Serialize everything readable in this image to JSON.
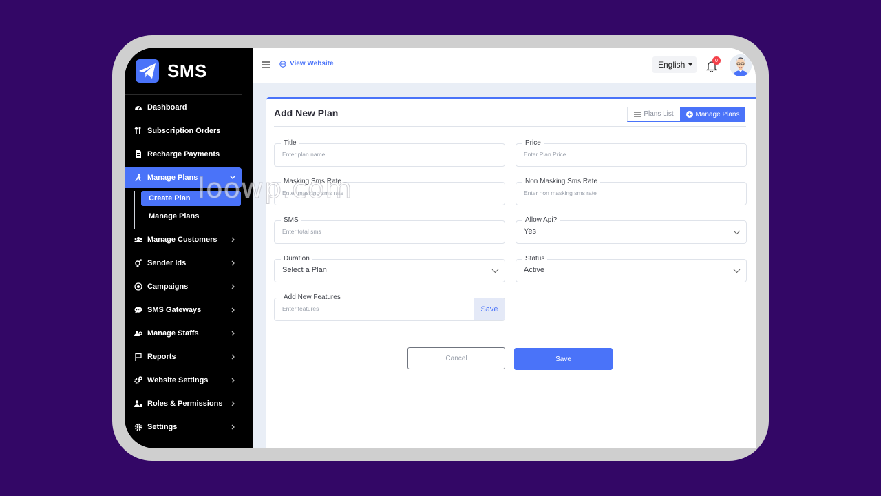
{
  "brand": {
    "name": "SMS",
    "accent": "#4a73f9"
  },
  "topbar": {
    "view_website": "View Website",
    "language": "English",
    "notification_count": "0"
  },
  "sidebar": {
    "items": [
      {
        "label": "Dashboard",
        "icon": "dashboard-icon"
      },
      {
        "label": "Subscription Orders",
        "icon": "sort-icon"
      },
      {
        "label": "Recharge Payments",
        "icon": "invoice-icon"
      },
      {
        "label": "Manage Plans",
        "icon": "walking-icon",
        "active": true,
        "expanded": true
      },
      {
        "label": "Manage Customers",
        "icon": "users-icon"
      },
      {
        "label": "Sender Ids",
        "icon": "gender-icon"
      },
      {
        "label": "Campaigns",
        "icon": "target-icon"
      },
      {
        "label": "SMS Gateways",
        "icon": "chat-icon"
      },
      {
        "label": "Manage Staffs",
        "icon": "staff-icon"
      },
      {
        "label": "Reports",
        "icon": "flag-icon"
      },
      {
        "label": "Website Settings",
        "icon": "cogs-icon"
      },
      {
        "label": "Roles & Permissions",
        "icon": "user-lock-icon"
      },
      {
        "label": "Settings",
        "icon": "gear-icon"
      }
    ],
    "sub_items": [
      {
        "label": "Create Plan",
        "active": true
      },
      {
        "label": "Manage Plans"
      }
    ]
  },
  "card": {
    "title": "Add New Plan",
    "plans_list": "Plans List",
    "manage_plans": "Manage Plans"
  },
  "form": {
    "title": {
      "label": "Title",
      "placeholder": "Enter plan name"
    },
    "price": {
      "label": "Price",
      "placeholder": "Enter Plan Price"
    },
    "masking": {
      "label": "Masking Sms Rate",
      "placeholder": "Enter masking sms rate"
    },
    "non_masking": {
      "label": "Non Masking Sms Rate",
      "placeholder": "Enter non masking sms rate"
    },
    "sms": {
      "label": "SMS",
      "placeholder": "Enter total sms"
    },
    "allow_api": {
      "label": "Allow Api?",
      "value": "Yes"
    },
    "duration": {
      "label": "Duration",
      "value": "Select a Plan"
    },
    "status": {
      "label": "Status",
      "value": "Active"
    },
    "features": {
      "label": "Add New Features",
      "placeholder": "Enter features",
      "button": "Save"
    },
    "cancel": "Cancel",
    "save": "Save"
  },
  "watermark": "loowp.com"
}
